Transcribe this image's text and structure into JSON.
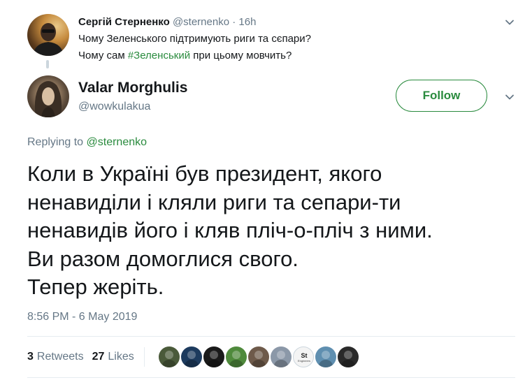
{
  "parent_tweet": {
    "name": "Сергій Стерненко",
    "handle": "@sternenko",
    "separator": "·",
    "time": "16h",
    "line1": "Чому Зеленського підтримують риги та сєпари?",
    "line2_prefix": "Чому сам ",
    "line2_hashtag": "#Зеленський",
    "line2_suffix": " при цьому мовчить?"
  },
  "tweet": {
    "name": "Valar Morghulis",
    "handle": "@wowkulakua",
    "follow_label": "Follow",
    "replying_prefix": "Replying to ",
    "replying_handle": "@sternenko",
    "text_lines": [
      "Коли в Україні був президент, якого",
      "ненавиділи і кляли риги та сепари-ти",
      "ненавидів його і кляв пліч-о-пліч з ними.",
      "Ви разом домоглися свого.",
      "Тепер жеріть."
    ],
    "timestamp": "8:56 PM - 6 May 2019"
  },
  "stats": {
    "retweets_count": "3",
    "retweets_label": "Retweets",
    "likes_count": "27",
    "likes_label": "Likes"
  },
  "likers": [
    {
      "icon": "avatar",
      "color": "#4a5a3a"
    },
    {
      "icon": "avatar",
      "color": "#1d3b5e"
    },
    {
      "icon": "avatar",
      "color": "#1a1a1a"
    },
    {
      "icon": "avatar",
      "color": "#4f8a3c"
    },
    {
      "icon": "avatar",
      "color": "#6e5a4a"
    },
    {
      "icon": "avatar",
      "color": "#8b98a8"
    },
    {
      "icon": "avatar",
      "color": "#f4f4f4",
      "line1": "St",
      "line2": "Engineers"
    },
    {
      "icon": "avatar",
      "color": "#5f8fb0"
    },
    {
      "icon": "avatar",
      "color": "#2a2a2a"
    }
  ],
  "colors": {
    "accent": "#2a8b3e",
    "muted": "#657786",
    "text": "#14171a",
    "divider": "#e6ecf0"
  }
}
